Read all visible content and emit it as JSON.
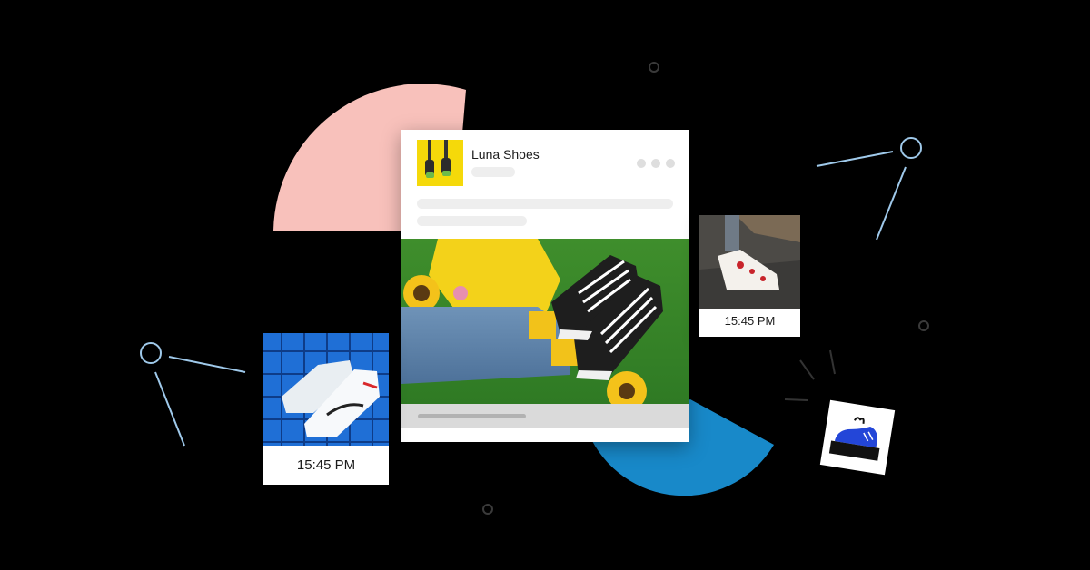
{
  "brand": {
    "name": "Luna Shoes"
  },
  "post": {
    "menu_icon": "more-dots-icon"
  },
  "cards": [
    {
      "time": "15:45 PM"
    },
    {
      "time": "15:45 PM"
    }
  ],
  "colors": {
    "background": "#000000",
    "pink_shape": "#f8c1bb",
    "blue_shape": "#1889c9",
    "line_blue": "#9fc9ea",
    "skeleton": "#eeeeee",
    "sticker_shoe": "#2346d8"
  }
}
